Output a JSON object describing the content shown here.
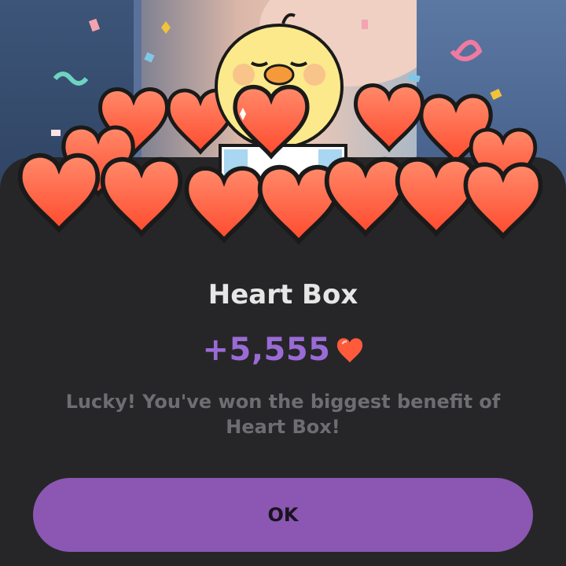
{
  "reward": {
    "title": "Heart Box",
    "amount": "+5,555",
    "message": "Lucky! You've won the biggest benefit of Heart Box!",
    "ok_label": "OK"
  },
  "colors": {
    "accent_purple": "#8b57b3",
    "amount_purple": "#9a6bd6",
    "heart_red": "#ff5a3c",
    "sheet_bg": "#262628"
  },
  "icons": {
    "mascot": "chick-holding-heart-icon",
    "heart": "heart-icon",
    "confetti": "confetti-icon"
  }
}
